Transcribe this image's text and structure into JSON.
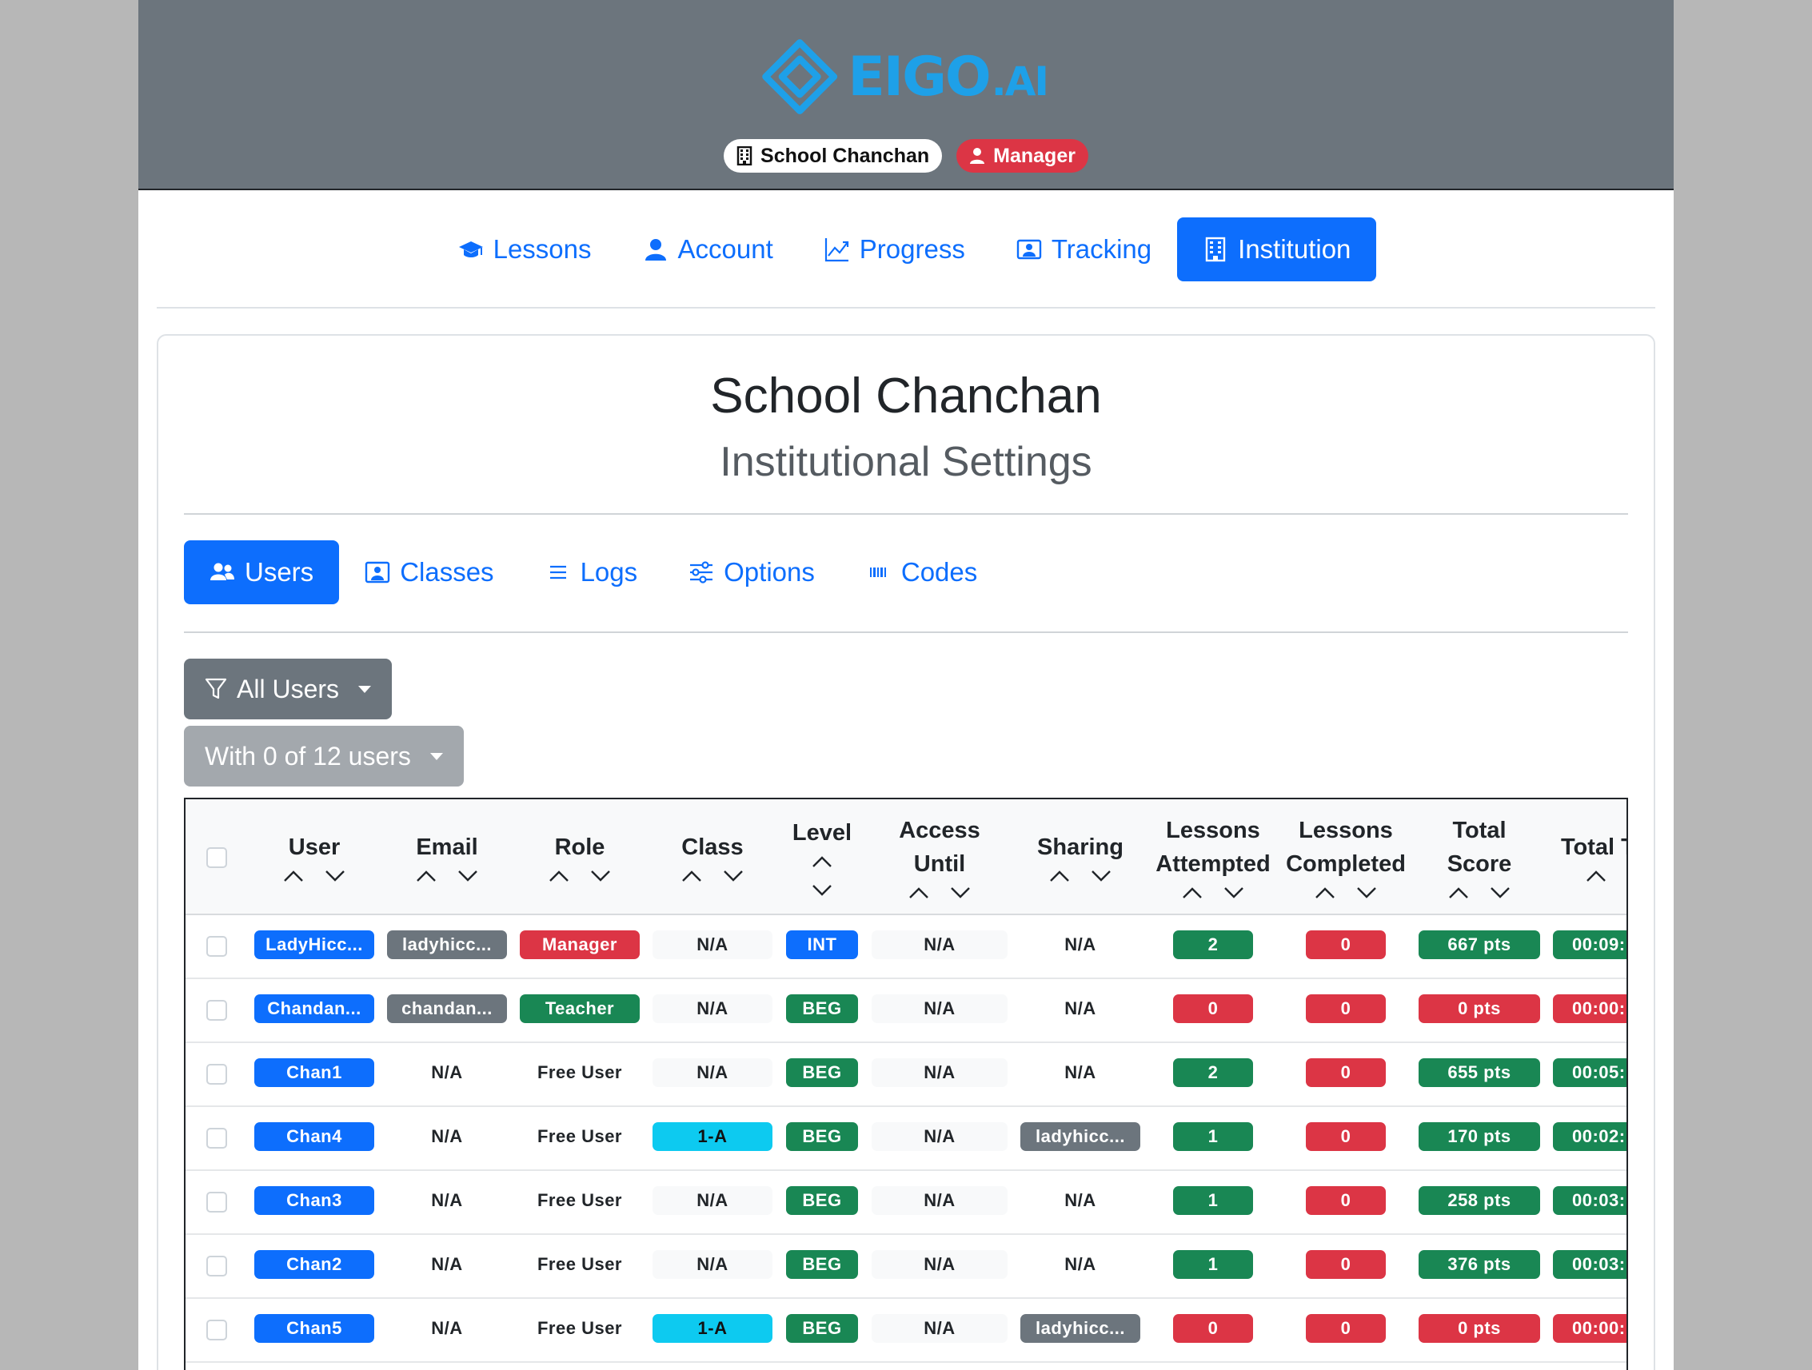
{
  "brand": {
    "name": "EIGO",
    "suffix": ".AI"
  },
  "header": {
    "school": "School Chanchan",
    "role": "Manager"
  },
  "main_nav": [
    {
      "label": "Lessons",
      "icon": "graduation-cap-icon",
      "active": false
    },
    {
      "label": "Account",
      "icon": "person-icon",
      "active": false
    },
    {
      "label": "Progress",
      "icon": "graph-up-icon",
      "active": false
    },
    {
      "label": "Tracking",
      "icon": "person-video-icon",
      "active": false
    },
    {
      "label": "Institution",
      "icon": "building-icon",
      "active": true
    }
  ],
  "card": {
    "title": "School Chanchan",
    "subtitle": "Institutional Settings"
  },
  "sub_nav": [
    {
      "label": "Users",
      "icon": "people-icon",
      "active": true
    },
    {
      "label": "Classes",
      "icon": "person-video-icon",
      "active": false
    },
    {
      "label": "Logs",
      "icon": "list-icon",
      "active": false
    },
    {
      "label": "Options",
      "icon": "sliders-icon",
      "active": false
    },
    {
      "label": "Codes",
      "icon": "barcode-icon",
      "active": false
    }
  ],
  "filter": {
    "label": "All Users"
  },
  "with_selection": {
    "label": "With 0 of 12 users"
  },
  "table": {
    "columns": [
      "User",
      "Email",
      "Role",
      "Class",
      "Level",
      "Access Until",
      "Sharing",
      "Lessons Attempted",
      "Lessons Completed",
      "Total Score",
      "Total Ti"
    ],
    "rows": [
      {
        "user": "LadyHicc...",
        "email": "ladyhicc...",
        "role": "Manager",
        "class": "N/A",
        "level": "INT",
        "access": "N/A",
        "sharing": "N/A",
        "attempted": "2",
        "completed": "0",
        "score": "667 pts",
        "time": "00:09:"
      },
      {
        "user": "Chandan...",
        "email": "chandan...",
        "role": "Teacher",
        "class": "N/A",
        "level": "BEG",
        "access": "N/A",
        "sharing": "N/A",
        "attempted": "0",
        "completed": "0",
        "score": "0 pts",
        "time": "00:00:"
      },
      {
        "user": "Chan1",
        "email": "N/A",
        "role": "Free User",
        "class": "N/A",
        "level": "BEG",
        "access": "N/A",
        "sharing": "N/A",
        "attempted": "2",
        "completed": "0",
        "score": "655 pts",
        "time": "00:05:"
      },
      {
        "user": "Chan4",
        "email": "N/A",
        "role": "Free User",
        "class": "1-A",
        "level": "BEG",
        "access": "N/A",
        "sharing": "ladyhicc...",
        "attempted": "1",
        "completed": "0",
        "score": "170 pts",
        "time": "00:02:"
      },
      {
        "user": "Chan3",
        "email": "N/A",
        "role": "Free User",
        "class": "N/A",
        "level": "BEG",
        "access": "N/A",
        "sharing": "N/A",
        "attempted": "1",
        "completed": "0",
        "score": "258 pts",
        "time": "00:03:"
      },
      {
        "user": "Chan2",
        "email": "N/A",
        "role": "Free User",
        "class": "N/A",
        "level": "BEG",
        "access": "N/A",
        "sharing": "N/A",
        "attempted": "1",
        "completed": "0",
        "score": "376 pts",
        "time": "00:03:"
      },
      {
        "user": "Chan5",
        "email": "N/A",
        "role": "Free User",
        "class": "1-A",
        "level": "BEG",
        "access": "N/A",
        "sharing": "ladyhicc...",
        "attempted": "0",
        "completed": "0",
        "score": "0 pts",
        "time": "00:00:"
      }
    ]
  },
  "colors": {
    "primary": "#0d6efd",
    "secondary": "#6c757d",
    "danger": "#dc3545",
    "success": "#198754",
    "info": "#0dcaf0",
    "brand": "#1ea0e8"
  }
}
